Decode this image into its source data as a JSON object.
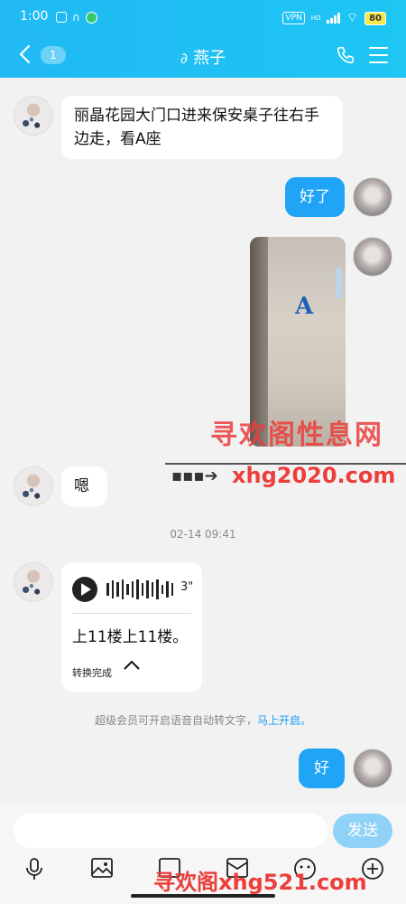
{
  "status_bar": {
    "time": "1:00",
    "vpn": "VPN",
    "hd": "HD",
    "battery": "80"
  },
  "header": {
    "back_count": "1",
    "contact_name": "燕子"
  },
  "messages": {
    "m1": "丽晶花园大门口进来保安桌子往右手边走，看A座",
    "m2": "好了",
    "photo_letter": "A",
    "m3": "嗯",
    "timestamp": "02-14 09:41",
    "voice_duration": "3\"",
    "voice_text": "上11楼上11楼。",
    "voice_done": "转换完成",
    "vip_note": "超级会员可开启语音自动转文字，",
    "vip_link": "马上开启。",
    "m4": "好"
  },
  "input": {
    "placeholder": "",
    "send_label": "发送"
  },
  "watermarks": {
    "w1": "寻欢阁性息网",
    "w2": "xhg2020.com",
    "w3": "寻欢阁xhg521.com"
  },
  "colors": {
    "header": "#21b9f4",
    "bubble_right": "#1fa4f6",
    "send": "#8fd1f7",
    "watermark": "#ec3e3b"
  }
}
